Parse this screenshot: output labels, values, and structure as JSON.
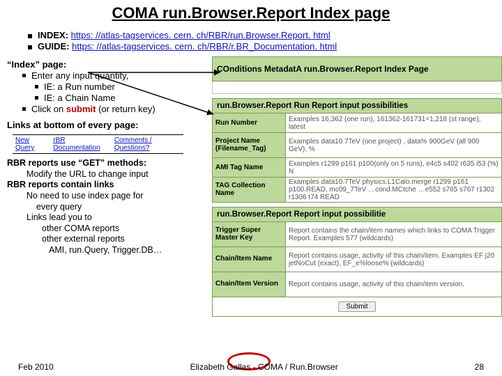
{
  "title": "COMA run.Browser.Report Index page",
  "urls": {
    "index_label": "INDEX: ",
    "index_url": "https: //atlas-tagservices. cern. ch/RBR/run.Browser.Report. html",
    "guide_label": "GUIDE: ",
    "guide_url": "https: //atlas-tagservices. cern. ch/RBR/r.BR_Documentation. html"
  },
  "left": {
    "index_heading": "“Index” page:",
    "enter": "Enter any input quantity,",
    "ie_run": "IE: a Run number",
    "ie_chain": "IE: a Chain Name",
    "click_prefix": "Click on ",
    "submit_word": "submit",
    "click_suffix": " (or return key)",
    "links_heading": "Links at bottom of every page:",
    "linkbar": {
      "a": "New Query",
      "b": "rBR Documentation",
      "c": "Comments / Questions?"
    },
    "rbrget_l1": "RBR reports use “GET” methods:",
    "rbrget_l2": "Modify the URL to change input",
    "rbrlinks_l1": "RBR reports contain links",
    "rbrlinks_l2": "No need to use index page for",
    "rbrlinks_l3": "every query",
    "rbrlinks_l4": "Links lead you to",
    "rbrlinks_l5": "other COMA reports",
    "rbrlinks_l6": "other external reports",
    "rbrlinks_l7": "AMI, run.Query, Trigger.DB…"
  },
  "panel": {
    "title": "COnditions MetadatA run.Browser.Report Index Page",
    "blank": "",
    "runreport_hdr": "run.Browser.Report Run Report input possibilities",
    "rows1": [
      {
        "label": "Run Number",
        "val": "Examples 16,362 (one run), 161362-161731=1,218 (st range), latest"
      },
      {
        "label": "Project Name (Filename_Tag)",
        "val": "Examples  data10 7TeV (one project) , data% 900GeV (all 900 GeV), %"
      },
      {
        "label": "AMI Tag Name",
        "val": "Examples  r1299 p161 p100(only on 5 runs),  e4c5 s402 r635 i53 (%) N"
      },
      {
        "label": "TAG Collection Name",
        "val": "Examples  data10.7TeV physics.L1Calo.merge r1299 p161 p100.READ, mc09_7TeV …cond.MCtche …e552 s765 s767 r1302 r1306 t74 READ"
      }
    ],
    "chainreport_hdr": "run.Browser.Report Report input possibilitie",
    "rows2": [
      {
        "label": "Trigger Super Master Key",
        "val": "Report contains the chain/item names which links to COMA Trigger Report. Examples  577 (wildcards)"
      },
      {
        "label": "Chain/Item Name",
        "val": "Report contains usage, act​ivity of this chain/item. Examples  EF j20 jetNoCut (exact),  EF_e%loose% (wildcards)"
      },
      {
        "label": "Chain/Item Version",
        "val": "Report contains usage, activity of this chain/item version."
      }
    ],
    "submit": "Submit"
  },
  "footer": {
    "left": "Feb 2010",
    "center": "Elizabeth Gallas - COMA / Run.Browser",
    "right": "28"
  }
}
